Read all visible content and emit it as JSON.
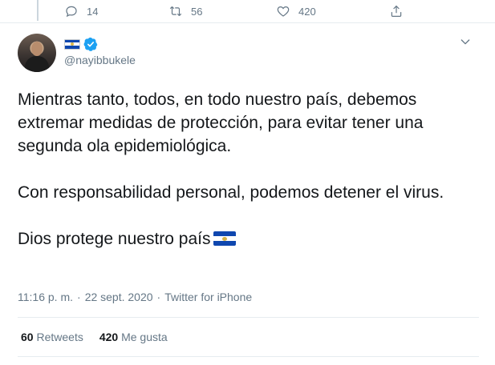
{
  "previous_tweet": {
    "reply_count": "14",
    "retweet_count": "56",
    "like_count": "420"
  },
  "tweet": {
    "handle": "@nayibbukele",
    "paragraphs": [
      "Mientras tanto, todos, en todo nuestro país, debemos extremar medidas de protección, para evitar tener una segunda ola epidemiológica.",
      "Con responsabilidad personal, podemos detener el virus.",
      "Dios protege nuestro país"
    ],
    "time": "11:16 p. m.",
    "separator": "·",
    "date": "22 sept. 2020",
    "source": "Twitter for iPhone",
    "stats": {
      "retweets_count": "60",
      "retweets_label": "Retweets",
      "likes_count": "420",
      "likes_label": "Me gusta"
    }
  },
  "colors": {
    "text": "#14171a",
    "secondary": "#657786",
    "verified": "#1da1f2",
    "divider": "#e6ecf0",
    "flag_blue": "#0f47af"
  },
  "icons": {
    "reply": "speech-bubble-icon",
    "retweet": "retweet-arrows-icon",
    "like": "heart-icon",
    "share": "share-upload-icon",
    "verified": "verified-badge-icon",
    "more": "chevron-down-icon"
  }
}
